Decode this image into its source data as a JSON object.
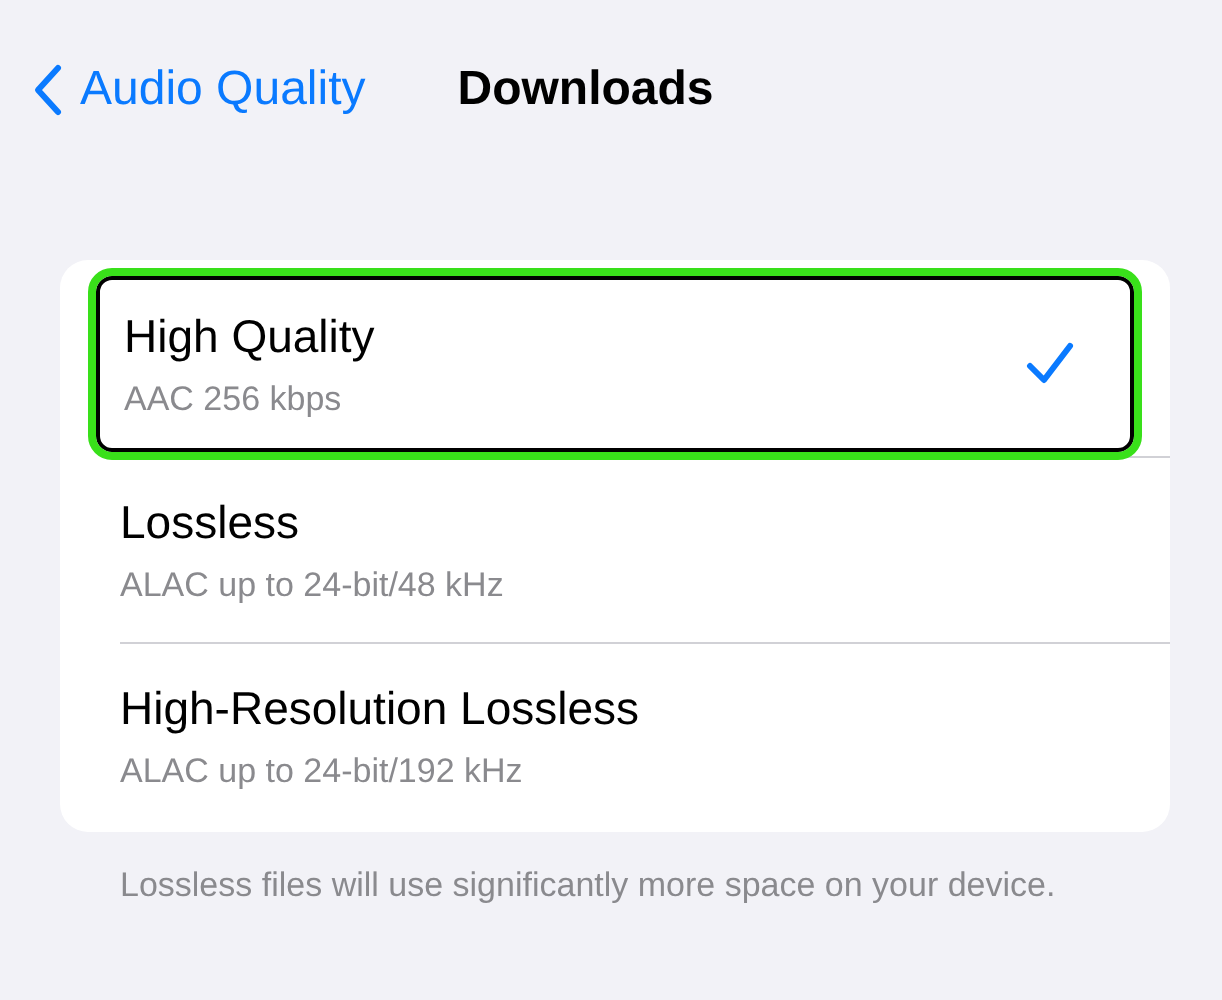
{
  "nav": {
    "back_label": "Audio Quality",
    "title": "Downloads"
  },
  "options": [
    {
      "title": "High Quality",
      "subtitle": "AAC 256 kbps",
      "selected": true,
      "highlighted": true
    },
    {
      "title": "Lossless",
      "subtitle": "ALAC up to 24-bit/48 kHz",
      "selected": false,
      "highlighted": false
    },
    {
      "title": "High-Resolution Lossless",
      "subtitle": "ALAC up to 24-bit/192 kHz",
      "selected": false,
      "highlighted": false
    }
  ],
  "footer": "Lossless files will use significantly more space on your device."
}
